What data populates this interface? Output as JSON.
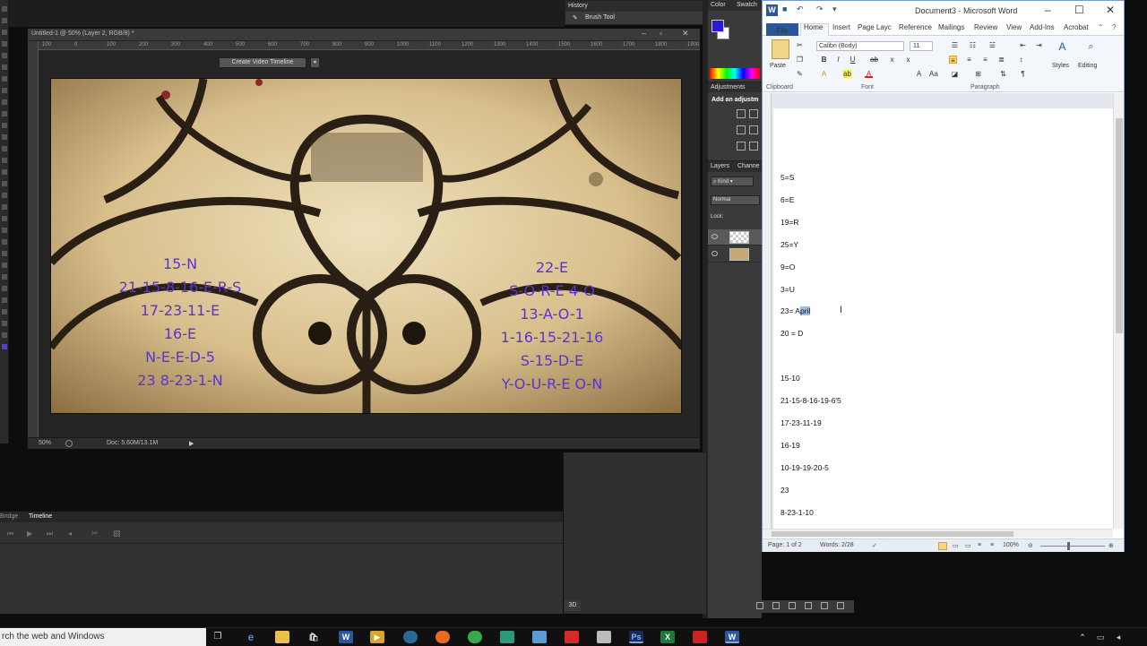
{
  "photoshop": {
    "doc_tab_title": "Untitled-1 @ 50% (Layer 2, RGB/8) *",
    "ruler_ticks": [
      "100",
      "50",
      "0",
      "50",
      "100",
      "150",
      "200",
      "250",
      "300",
      "350",
      "400",
      "450",
      "500",
      "550",
      "600",
      "650",
      "700",
      "750",
      "800",
      "850",
      "900",
      "950",
      "1000",
      "1050",
      "1100",
      "1150",
      "1200",
      "1250",
      "1300",
      "1350",
      "1400",
      "1450",
      "1500",
      "1550",
      "1600",
      "1650",
      "1700",
      "1750",
      "1800",
      "1850",
      "1900"
    ],
    "zoom": "50%",
    "doc_info": "Doc: 5.60M/13.1M",
    "history_title": "History",
    "history_item": "Brush Tool",
    "color_tabs": [
      "Color",
      "Swatch"
    ],
    "adjustments_title": "Adjustments",
    "adjustments_sub": "Add an adjustm",
    "layers_tabs": [
      "Layers",
      "Channe"
    ],
    "layers_kind": "Kind",
    "blend_mode": "Normal",
    "lock_label": "Lock:",
    "bottom_tabs": [
      "Bridge",
      "Timeline"
    ],
    "create_timeline": "Create Video Timeline",
    "panel_3d": "3D",
    "foreground_color": "#2a1bd6",
    "canvas_notes_left": [
      "15-N",
      "21-15-8-16-E-R-S",
      "17-23-11-E",
      "16-E",
      "N-E-E-D-5",
      "23  8-23-1-N"
    ],
    "canvas_notes_right": [
      "22-E",
      "S-O-R-E  4-O",
      "13-A-O-1",
      "1-16-15-21-16",
      "S-15-D-E",
      "Y-O-U-R-E  O-N"
    ]
  },
  "word": {
    "window_title": "Document3 - Microsoft Word",
    "window_controls": [
      "–",
      "☐",
      "✕"
    ],
    "tabs": [
      "File",
      "Home",
      "Insert",
      "Page Layc",
      "Reference",
      "Mailings",
      "Review",
      "View",
      "Add-Ins",
      "Acrobat"
    ],
    "font_name": "Calibri (Body)",
    "font_size": "11",
    "paste_label": "Paste",
    "styles_label": "Styles",
    "editing_label": "Editing",
    "groups": [
      "Clipboard",
      "Font",
      "Paragraph"
    ],
    "doc_lines_top": [
      "5=S",
      "6=E",
      "19=R",
      "25=Y",
      "9=O",
      "3=U"
    ],
    "doc_line_sel_prefix": "23= A",
    "doc_line_sel_highlight": "pril",
    "doc_line_after": "20 = D",
    "doc_lines_bottom": [
      "15-10",
      "21-15-8-16-19-6'5",
      "17-23-11-19",
      "16-19",
      "10-19-19-20-5",
      "23",
      "8-23-1-10"
    ],
    "status_page": "Page: 1 of 2",
    "status_words": "Words: 2/28",
    "status_zoom": "100%"
  },
  "taskbar": {
    "search_text": "rch the web and Windows"
  }
}
